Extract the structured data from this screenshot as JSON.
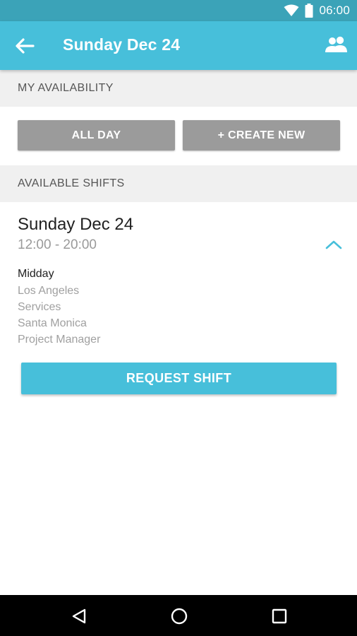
{
  "status_bar": {
    "time": "06:00",
    "icons": [
      "wifi-icon",
      "battery-icon"
    ]
  },
  "app_bar": {
    "title": "Sunday Dec 24",
    "back_icon": "arrow-left-icon",
    "action_icon": "people-icon"
  },
  "availability": {
    "header": "MY AVAILABILITY",
    "buttons": [
      {
        "label": "ALL DAY"
      },
      {
        "label": "+ CREATE NEW"
      }
    ]
  },
  "shifts": {
    "header": "AVAILABLE SHIFTS",
    "items": [
      {
        "date": "Sunday Dec 24",
        "time": "12:00 - 20:00",
        "expanded_icon": "chevron-up-icon",
        "name": "Midday",
        "details": [
          "Los Angeles",
          "Services",
          "Santa Monica",
          "Project Manager"
        ],
        "action_label": "REQUEST SHIFT"
      }
    ]
  },
  "nav_bar": {
    "icons": [
      "back-triangle-icon",
      "home-circle-icon",
      "recents-square-icon"
    ]
  },
  "colors": {
    "primary": "#47bfda",
    "status_bar": "#3ba3b8",
    "button_gray": "#9b9b9b",
    "section_bg": "#f0f0f0"
  }
}
